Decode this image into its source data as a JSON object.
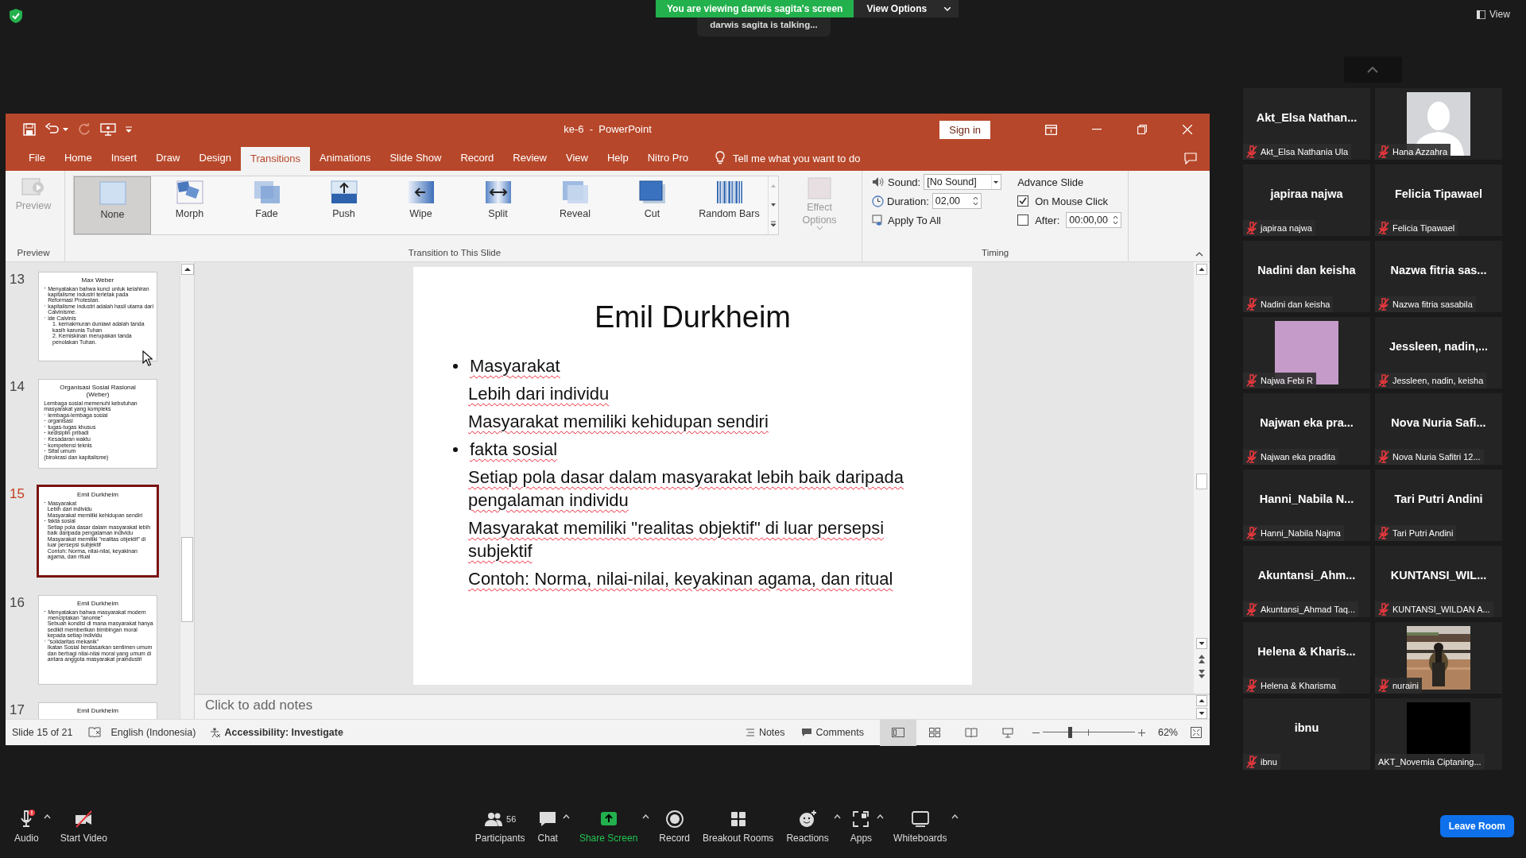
{
  "share_banner": {
    "text": "You are viewing darwis sagita's screen",
    "view_options": "View Options",
    "talking": "darwis sagita is talking..."
  },
  "view_button": "View",
  "powerpoint": {
    "title": "ke-6  -  PowerPoint",
    "sign_in": "Sign in",
    "tabs": [
      {
        "label": "File",
        "selected": false
      },
      {
        "label": "Home",
        "selected": false
      },
      {
        "label": "Insert",
        "selected": false
      },
      {
        "label": "Draw",
        "selected": false
      },
      {
        "label": "Design",
        "selected": false
      },
      {
        "label": "Transitions",
        "selected": true
      },
      {
        "label": "Animations",
        "selected": false
      },
      {
        "label": "Slide Show",
        "selected": false
      },
      {
        "label": "Record",
        "selected": false
      },
      {
        "label": "Review",
        "selected": false
      },
      {
        "label": "View",
        "selected": false
      },
      {
        "label": "Help",
        "selected": false
      },
      {
        "label": "Nitro Pro",
        "selected": false
      }
    ],
    "tell_me": "Tell me what you want to do",
    "preview": {
      "label": "Preview",
      "disabled": true
    },
    "group_labels": [
      "Preview",
      "Transition to This Slide",
      "Timing"
    ],
    "transitions": [
      {
        "label": "None",
        "kind": "none",
        "selected": true
      },
      {
        "label": "Morph",
        "kind": "morph",
        "selected": false
      },
      {
        "label": "Fade",
        "kind": "fade",
        "selected": false
      },
      {
        "label": "Push",
        "kind": "push",
        "selected": false
      },
      {
        "label": "Wipe",
        "kind": "wipe",
        "selected": false
      },
      {
        "label": "Split",
        "kind": "split",
        "selected": false
      },
      {
        "label": "Reveal",
        "kind": "reveal",
        "selected": false
      },
      {
        "label": "Cut",
        "kind": "cut",
        "selected": false
      },
      {
        "label": "Random Bars",
        "kind": "bars",
        "selected": false
      }
    ],
    "effect_options": {
      "label": "Effect Options",
      "disabled": true
    },
    "sound": {
      "label": "Sound:",
      "value": "[No Sound]"
    },
    "duration": {
      "label": "Duration:",
      "value": "02,00"
    },
    "apply_to_all": "Apply To All",
    "advance": {
      "title": "Advance Slide",
      "on_mouse_click": {
        "label": "On Mouse Click",
        "checked": true
      },
      "after": {
        "label": "After:",
        "checked": false,
        "value": "00:00,00"
      }
    },
    "thumbnails": [
      {
        "number": "13",
        "selected": false,
        "title": "Max Weber",
        "paragraphs": [
          {
            "kind": "bullet",
            "text": "Menyatakan bahwa kunci untuk kelahiran kapitalisme industri terletak pada Reformasi Protestan."
          },
          {
            "kind": "bullet",
            "text": "kapitalisme industri adalah hasil utama dari Calvinisme."
          },
          {
            "kind": "bullet",
            "text": "ide Calvinis"
          },
          {
            "kind": "sub",
            "text": "1. kemakmuran duniawi adalah tanda kasih karunia Tuhan"
          },
          {
            "kind": "sub",
            "text": "2. Kemiskinan merupakan tanda penolakan Tuhan."
          }
        ]
      },
      {
        "number": "14",
        "selected": false,
        "title": "Organisasi Sosial Rasional (Weber)",
        "paragraphs": [
          {
            "kind": "note",
            "text": "Lembaga sosial memenuhi kebutuhan masyarakat yang kompleks"
          },
          {
            "kind": "bullet",
            "text": "lembaga-lembaga sosial"
          },
          {
            "kind": "bullet",
            "text": "organisasi"
          },
          {
            "kind": "bullet",
            "text": "tugas-tugas khusus"
          },
          {
            "kind": "bullet",
            "text": "kedisiplin pribadi"
          },
          {
            "kind": "bullet",
            "text": "Kesadaran waktu"
          },
          {
            "kind": "bullet",
            "text": "kompetensi teknis"
          },
          {
            "kind": "bullet",
            "text": "Sifat umum"
          },
          {
            "kind": "note",
            "text": "(birokrasi dan kapitalisme)"
          }
        ]
      },
      {
        "number": "15",
        "selected": true,
        "title": "Emil Durkheim",
        "paragraphs": [
          {
            "kind": "bullet",
            "text": "Masyarakat"
          },
          {
            "kind": "plain",
            "text": "Lebih dari individu"
          },
          {
            "kind": "plain",
            "text": "Masyarakat memiliki kehidupan sendiri"
          },
          {
            "kind": "bullet",
            "text": "fakta sosial"
          },
          {
            "kind": "plain",
            "text": "Setiap pola dasar dalam masyarakat lebih baik daripada pengalaman individu"
          },
          {
            "kind": "plain",
            "text": "Masyarakat memiliki \"realitas objektif\" di luar persepsi subjektif"
          },
          {
            "kind": "plain",
            "text": "Contoh: Norma, nilai-nilai, keyakinan agama, dan ritual"
          }
        ]
      },
      {
        "number": "16",
        "selected": false,
        "title": "Emil Durkheim",
        "paragraphs": [
          {
            "kind": "bullet",
            "text": "Menyatakan bahwa masyarakat modern menciptakan \"anomie\""
          },
          {
            "kind": "plain",
            "text": "Sebuah kondisi di mana masyarakat hanya sedikit memberikan bimbingan moral kepada setiap individu"
          },
          {
            "kind": "bullet",
            "text": "\"solidaritas mekanik\""
          },
          {
            "kind": "plain",
            "text": "Ikatan Sosial berdasarkan sentimen umum dan berbagi nilai-nilai moral yang umum di antara anggota masyarakat praindustri"
          }
        ]
      },
      {
        "number": "17",
        "selected": false,
        "title": "Emil Durkheim"
      }
    ],
    "slide": {
      "title": "Emil Durkheim",
      "paragraphs": [
        {
          "kind": "bullet",
          "text": "Masyarakat"
        },
        {
          "kind": "plain",
          "text": "Lebih dari individu"
        },
        {
          "kind": "plain",
          "text": "Masyarakat memiliki kehidupan sendiri"
        },
        {
          "kind": "bullet",
          "text": "fakta sosial"
        },
        {
          "kind": "plain",
          "text": "Setiap pola dasar dalam masyarakat lebih baik daripada pengalaman individu"
        },
        {
          "kind": "plain",
          "text": "Masyarakat memiliki \"realitas objektif\" di luar persepsi subjektif"
        },
        {
          "kind": "plain",
          "text": "Contoh: Norma, nilai-nilai, keyakinan agama, dan ritual"
        }
      ]
    },
    "notes_placeholder": "Click to add notes",
    "status": {
      "slide": "Slide 15 of 21",
      "language": "English (Indonesia)",
      "accessibility": "Accessibility: Investigate",
      "notes": "Notes",
      "comments": "Comments",
      "zoom": "62%",
      "zoom_slider": {
        "level": 0.29
      }
    }
  },
  "gallery": [
    {
      "kind": "name",
      "name": "Akt_Elsa Nathan...",
      "label": "Akt_Elsa Nathania Ula",
      "muted": true
    },
    {
      "kind": "avatar",
      "label": "Hana Azzahra",
      "muted": true
    },
    {
      "kind": "name",
      "name": "japiraa najwa",
      "label": "japiraa najwa",
      "muted": true
    },
    {
      "kind": "name",
      "name": "Felicia Tipawael",
      "label": "Felicia Tipawael",
      "muted": true
    },
    {
      "kind": "name",
      "name": "Nadini dan keisha",
      "label": "Nadini dan keisha",
      "muted": true
    },
    {
      "kind": "name",
      "name": "Nazwa fitria sas...",
      "label": "Nazwa fitria sasabila",
      "muted": true
    },
    {
      "kind": "swatch",
      "label": "Najwa Febi R",
      "muted": true
    },
    {
      "kind": "name",
      "name": "Jessleen, nadin,...",
      "label": "Jessleen, nadin, keisha",
      "muted": true
    },
    {
      "kind": "name",
      "name": "Najwan eka pra...",
      "label": "Najwan eka pradita",
      "muted": true
    },
    {
      "kind": "name",
      "name": "Nova Nuria Safi...",
      "label": "Nova Nuria Safitri 12...",
      "muted": true
    },
    {
      "kind": "name",
      "name": "Hanni_Nabila N...",
      "label": "Hanni_Nabila Najma",
      "muted": true
    },
    {
      "kind": "name",
      "name": "Tari Putri Andini",
      "label": "Tari Putri Andini",
      "muted": true
    },
    {
      "kind": "name",
      "name": "Akuntansi_Ahm...",
      "label": "Akuntansi_Ahmad Taq...",
      "muted": true
    },
    {
      "kind": "name",
      "name": "KUNTANSI_WIL...",
      "label": "KUNTANSI_WILDAN A...",
      "muted": true
    },
    {
      "kind": "name",
      "name": "Helena & Kharis...",
      "label": "Helena & Kharisma",
      "muted": true
    },
    {
      "kind": "picture",
      "label": "nuraini",
      "muted": true
    },
    {
      "kind": "name",
      "name": "ibnu",
      "label": "ibnu",
      "muted": true
    },
    {
      "kind": "dark",
      "label": "AKT_Novemia Ciptaning...",
      "muted": false
    }
  ],
  "toolbar": {
    "left": [
      {
        "label": "Audio",
        "kind": "audio",
        "caret": true
      },
      {
        "label": "Start Video",
        "kind": "video",
        "caret": false
      }
    ],
    "center": [
      {
        "label": "Participants",
        "kind": "participants",
        "count": "56",
        "caret": false
      },
      {
        "label": "Chat",
        "kind": "chat",
        "caret": true
      },
      {
        "label": "Share Screen",
        "kind": "share",
        "caret": true
      },
      {
        "label": "Record",
        "kind": "record",
        "caret": false
      },
      {
        "label": "Breakout Rooms",
        "kind": "breakout",
        "caret": false
      },
      {
        "label": "Reactions",
        "kind": "reactions",
        "caret": true
      },
      {
        "label": "Apps",
        "kind": "apps",
        "caret": true
      },
      {
        "label": "Whiteboards",
        "kind": "whiteboards",
        "caret": true
      }
    ],
    "leave": "Leave Room"
  }
}
